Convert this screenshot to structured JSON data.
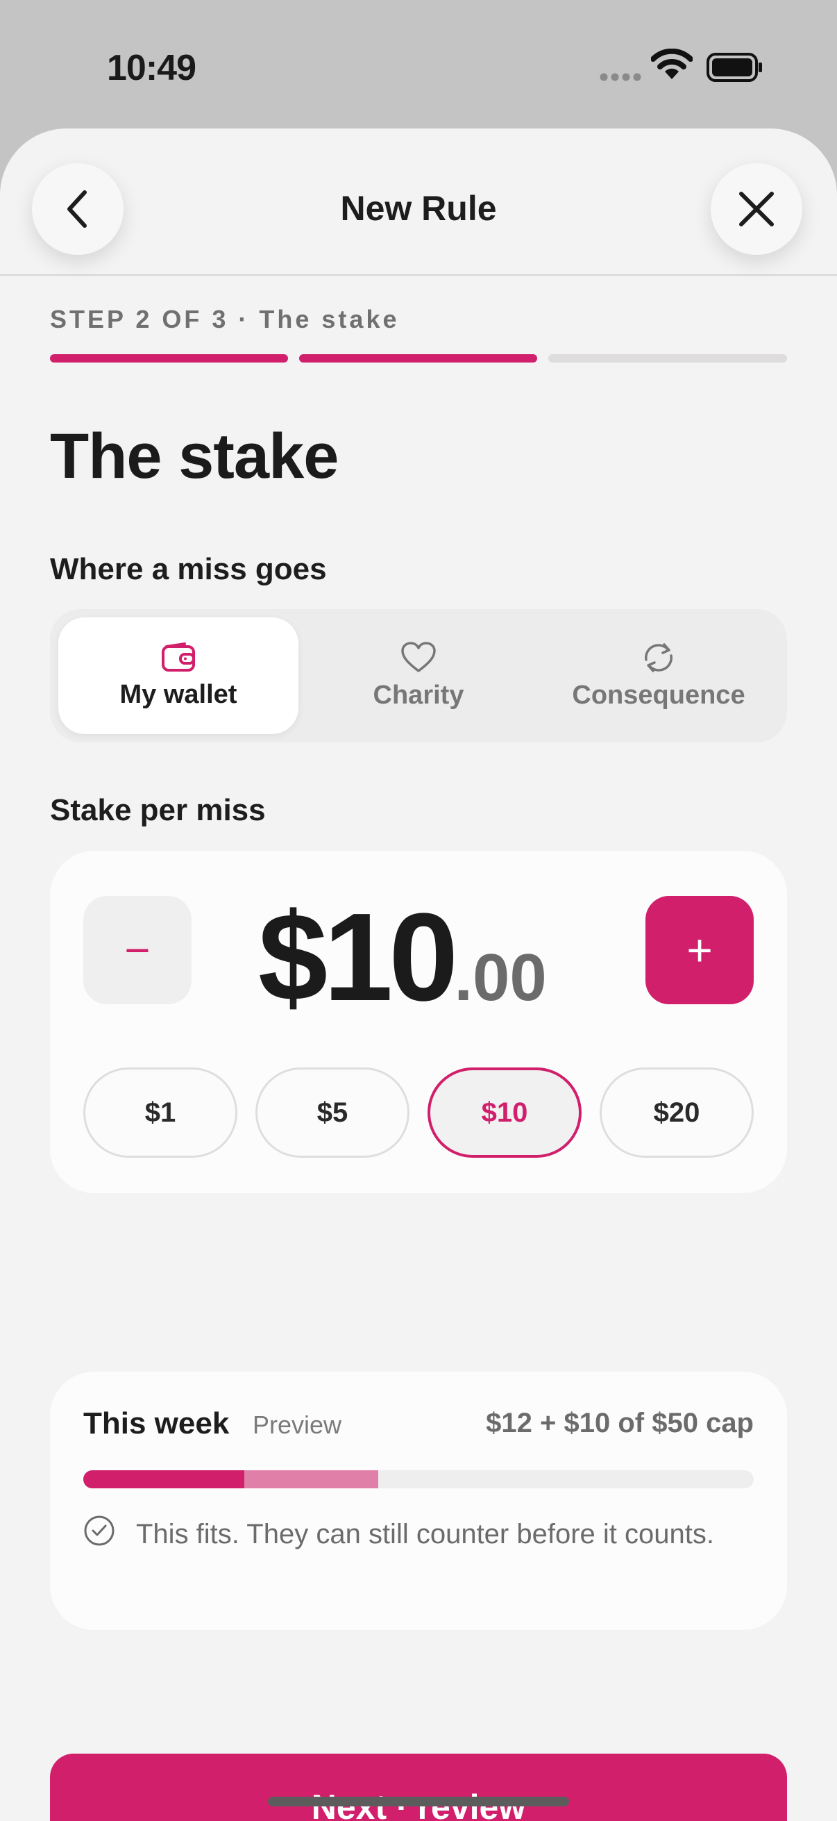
{
  "status_bar": {
    "time": "10:49"
  },
  "nav": {
    "title": "New Rule",
    "back_icon": "chevron-left-icon",
    "close_icon": "close-icon"
  },
  "progress": {
    "label": "STEP 2 OF 3 · The stake",
    "current_step": 2,
    "total_steps": 3
  },
  "page": {
    "title": "The stake"
  },
  "destination": {
    "label": "Where a miss goes",
    "options": [
      {
        "label": "My wallet",
        "icon": "wallet-icon",
        "selected": true
      },
      {
        "label": "Charity",
        "icon": "heart-icon",
        "selected": false
      },
      {
        "label": "Consequence",
        "icon": "repeat-icon",
        "selected": false
      }
    ]
  },
  "stake": {
    "label": "Stake per miss",
    "amount_main": "$10",
    "amount_cents": ".00",
    "decrement_label": "−",
    "increment_label": "+",
    "presets": [
      {
        "label": "$1",
        "selected": false
      },
      {
        "label": "$5",
        "selected": false
      },
      {
        "label": "$10",
        "selected": true
      },
      {
        "label": "$20",
        "selected": false
      }
    ]
  },
  "week": {
    "title": "This week",
    "badge": "Preview",
    "summary": "$12 + $10 of $50 cap",
    "current": 12,
    "added": 10,
    "cap": 50,
    "note": "This fits. They can still counter before it counts.",
    "note_icon": "check-circle-icon"
  },
  "cta": {
    "label": "Next · review"
  },
  "colors": {
    "accent": "#d11f6c",
    "accent_light": "#e07fa8"
  }
}
